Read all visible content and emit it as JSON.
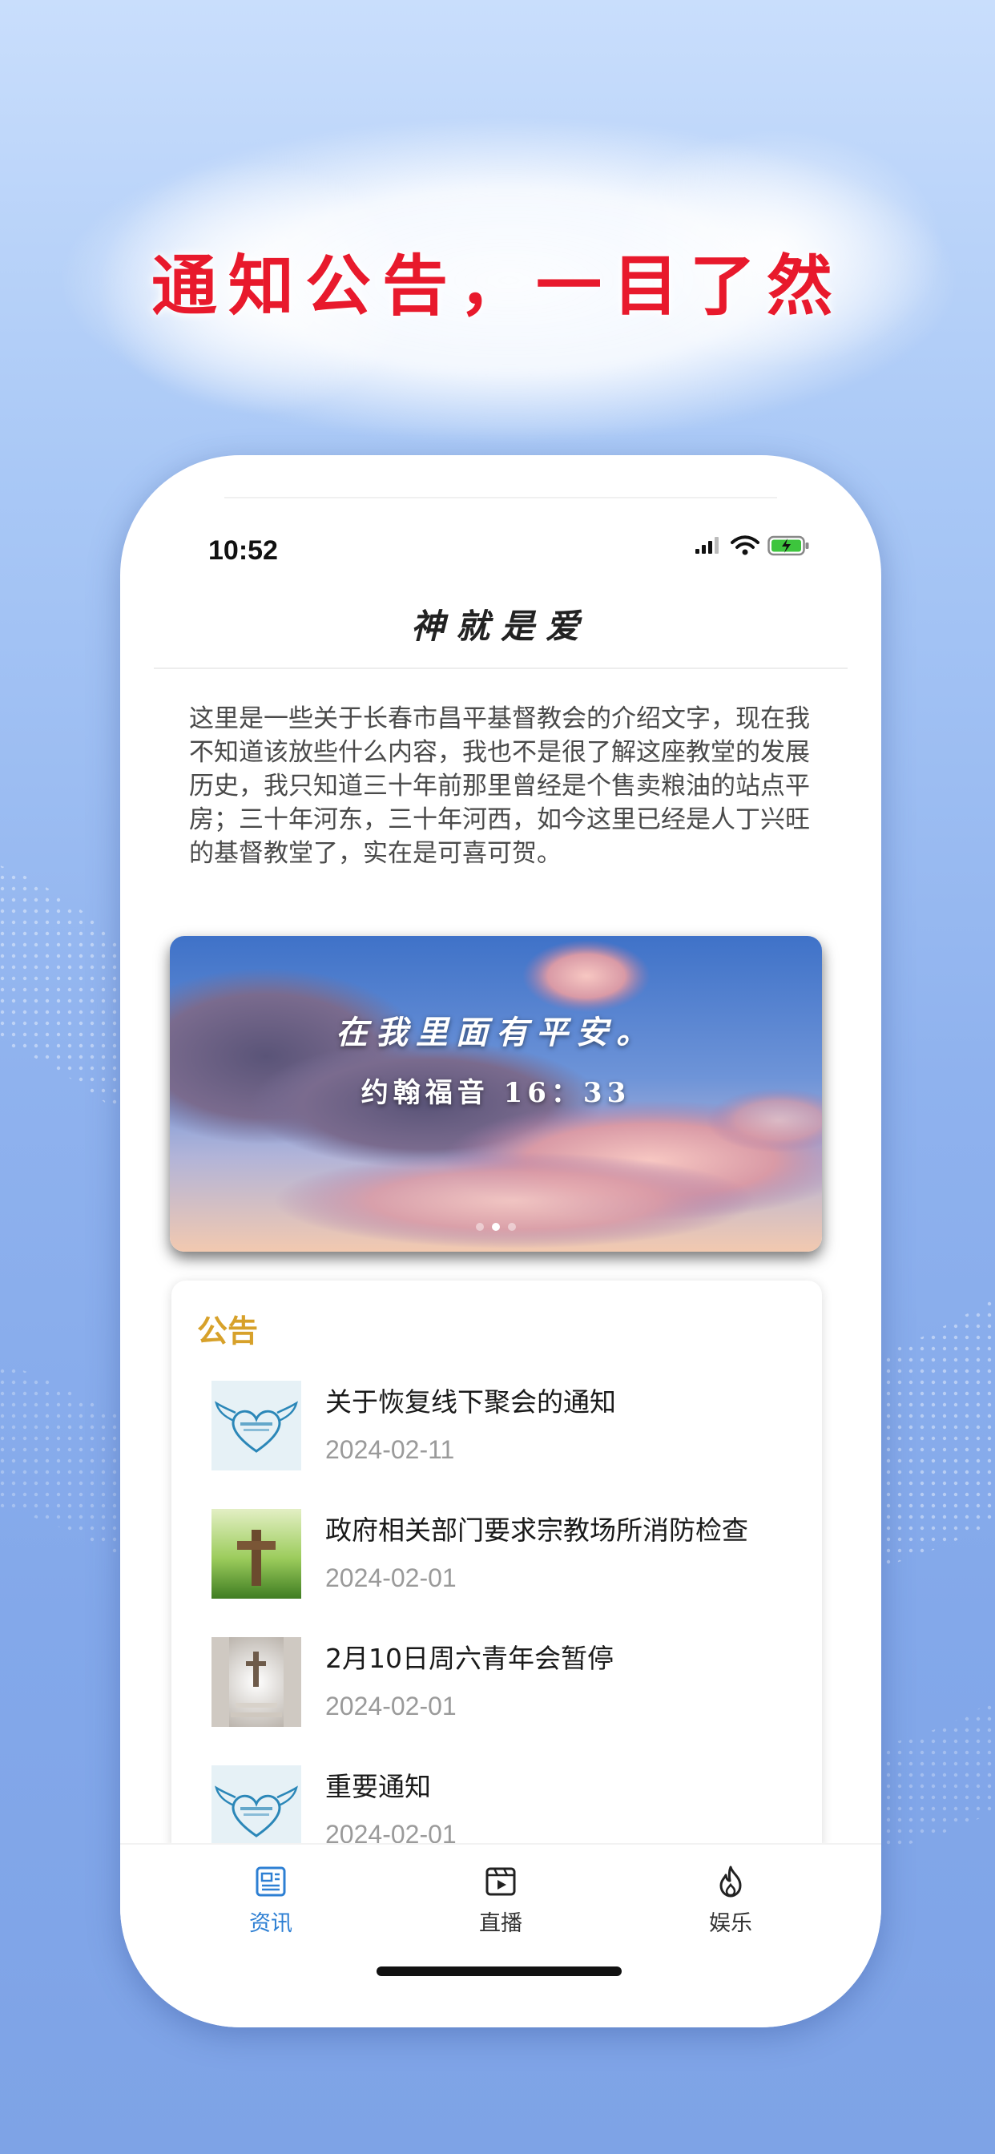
{
  "headline": "通知公告，一目了然",
  "status_bar": {
    "time": "10:52",
    "icons": [
      "signal-icon",
      "wifi-icon",
      "battery-charging-icon"
    ]
  },
  "app": {
    "title": "神就是爱",
    "intro": "这里是一些关于长春市昌平基督教会的介绍文字，现在我不知道该放些什么内容，我也不是很了解这座教堂的发展历史，我只知道三十年前那里曾经是个售卖粮油的站点平房；三十年河东，三十年河西，如今这里已经是人丁兴旺的基督教堂了，实在是可喜可贺。"
  },
  "banner": {
    "line1": "在我里面有平安。",
    "line2": "约翰福音 16：33",
    "page_count": 3,
    "active_index": 1
  },
  "notices": {
    "title": "公告",
    "items": [
      {
        "title": "关于恢复线下聚会的通知",
        "date": "2024-02-11",
        "thumb": "heart-wings-logo"
      },
      {
        "title": "政府相关部门要求宗教场所消防检查",
        "date": "2024-02-01",
        "thumb": "wooden-cross-on-grass"
      },
      {
        "title": "2月10日周六青年会暂停",
        "date": "2024-02-01",
        "thumb": "cross-in-light-corridor"
      },
      {
        "title": "重要通知",
        "date": "2024-02-01",
        "thumb": "heart-wings-logo"
      }
    ]
  },
  "tabbar": {
    "tabs": [
      {
        "label": "资讯",
        "icon": "news-icon",
        "active": true
      },
      {
        "label": "直播",
        "icon": "video-icon",
        "active": false
      },
      {
        "label": "娱乐",
        "icon": "fire-icon",
        "active": false
      }
    ]
  },
  "colors": {
    "headline": "#e8192c",
    "notice_title": "#d7a12a",
    "tab_active": "#2d7fd3",
    "date": "#9a9a9a"
  }
}
